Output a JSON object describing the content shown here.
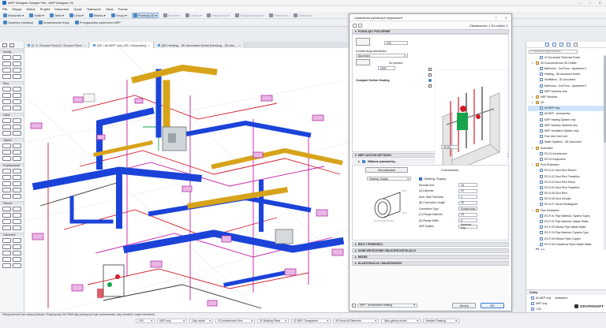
{
  "window": {
    "title": "MEP Designer Sample File - MEP Designer 29"
  },
  "menu": [
    "Plik",
    "Edycja",
    "Widok",
    "Projekt",
    "Dokument",
    "Opcje",
    "Teamwork",
    "Okna",
    "Pomoc"
  ],
  "toolbar1": [
    {
      "label": "Wskaźnik",
      "active": false
    },
    {
      "label": "Siatki",
      "active": false
    },
    {
      "label": "Tekst",
      "active": false
    },
    {
      "label": "Linia",
      "active": false
    },
    {
      "label": "Miarka",
      "active": false
    },
    {
      "label": "Grupy",
      "active": false
    },
    {
      "label": "Przekrój 3D",
      "active": true
    },
    {
      "label": "Pomiar",
      "active": false,
      "dim": true
    },
    {
      "label": "Ustaw",
      "active": false,
      "dim": true
    },
    {
      "label": "Połączenie",
      "active": false,
      "dim": true
    },
    {
      "label": "Edycja bryłowa",
      "active": false,
      "dim": true
    },
    {
      "label": "Przesuń",
      "active": false,
      "dim": true
    },
    {
      "label": "Zastosuj",
      "active": false,
      "dim": true
    }
  ],
  "toolbar2": [
    {
      "label": "Systemy instalacji"
    },
    {
      "label": "Sprawdzanie trasy"
    },
    {
      "label": "Przeglądarka systemów MEP"
    }
  ],
  "left_sections": [
    {
      "title": "Kanały",
      "rows": 4
    },
    {
      "title": "Rury",
      "rows": 4
    },
    {
      "title": "Kable",
      "rows": 3
    },
    {
      "title": "Ogólne",
      "rows": 3
    },
    {
      "title": "Projektowanie",
      "rows": 5
    },
    {
      "title": "Główne",
      "rows": 4
    },
    {
      "title": "Dokument",
      "rows": 5
    }
  ],
  "tabs": [
    {
      "label": "[2. 0. Ground Floor] 0. Ground Floor",
      "active": false
    },
    {
      "label": "[3D / All MEP only (3D / Wszystko)]",
      "active": true
    },
    {
      "label": "[3D Heating - 3D document Detail (Heating - 3D doc...",
      "active": false
    }
  ],
  "dialog": {
    "title": "Ustawienia wybranych wyposażeń",
    "selected": "Zaznaczono: 1 Do zmian: 1",
    "sec_floor": "PODGLĄD I POŁOŻENIE",
    "floor_value": "200",
    "construction_label": "Konstrukcja elementu:",
    "construction_value": "Basement",
    "level_label": "Do poziomu:",
    "level_value": "2000",
    "element_name": "Compact Dielion Heating",
    "preview_number": "09.537",
    "sec_custom": "MEP CUSTOM SETTINGS",
    "sub_params": "Własne parametry...",
    "tab_visualization": "Visualization",
    "tab_connections": "Connections",
    "conn_left_label": "Heating, Supply",
    "conn_right_label": "Heating, Supply",
    "param_rows": [
      {
        "label": "Nominal Size",
        "value": "15"
      },
      {
        "label": "(A) Diameter",
        "value": "22"
      },
      {
        "label": "Nom. Wall Thickness",
        "value": "1"
      },
      {
        "label": "(B) Connection Length",
        "value": "15"
      },
      {
        "label": "Connection Type",
        "value": "Kołnierzowe"
      },
      {
        "label": "(C) Flange Diameter",
        "value": "25"
      },
      {
        "label": "(D) Flange Width",
        "value": "4"
      },
      {
        "label": "MEP System",
        "value": "Hydronic Sup"
      }
    ],
    "sec_rzut": "RZUT I PRZEKRÓJ",
    "sec_dane": "DANE WEJŚCIOWE OBLICZEŃ INSTALACJI",
    "sec_model": "MODEL",
    "sec_klas": "KLASYFIKACJA I WŁAŚCIWOŚCI",
    "footer_label": "MEP - Accessories Heating",
    "cancel": "Anuluj",
    "ok": "OK"
  },
  "nav": {
    "search_placeholder": "Przeszukaj Mapę widoków",
    "items": [
      {
        "label": "02 Document Technical Room",
        "level": 2,
        "type": "doc"
      },
      {
        "label": "3D Documents and 3D Details",
        "level": 1,
        "type": "folder",
        "open": true
      },
      {
        "label": "Bathroom - 2nd Floor - Apartment 1",
        "level": 2,
        "type": "doc"
      },
      {
        "label": "Heating - 3D document Detail",
        "level": 2,
        "type": "doc"
      },
      {
        "label": "Ventilation - 3D Document",
        "level": 2,
        "type": "doc"
      },
      {
        "label": "Bathroom - 2nd Floor - Apartment 2",
        "level": 2,
        "type": "doc"
      },
      {
        "label": "MEP Systems only",
        "level": 2,
        "type": "doc"
      },
      {
        "label": "MEP Sections",
        "level": 1,
        "type": "folder",
        "open": true
      },
      {
        "label": "3D",
        "level": 1,
        "type": "folder",
        "open": true
      },
      {
        "label": "All MEP only",
        "level": 2,
        "type": "doc",
        "selected": true
      },
      {
        "label": "All MEP - Axonometry",
        "level": 2,
        "type": "doc"
      },
      {
        "label": "MEP Heating System only",
        "level": 2,
        "type": "doc"
      },
      {
        "label": "MEP Sanitary Systems only",
        "level": 2,
        "type": "doc"
      },
      {
        "label": "MEP Ventilation System only",
        "level": 2,
        "type": "doc"
      },
      {
        "label": "Flue Vent Vent Unit",
        "level": 2,
        "type": "doc"
      },
      {
        "label": "Water Systems - 3D Document",
        "level": 2,
        "type": "doc"
      },
      {
        "label": "Schedules",
        "level": 1,
        "type": "folder",
        "open": true
      },
      {
        "label": "ES-01 Accessories",
        "level": 2,
        "type": "doc"
      },
      {
        "label": "ES-02 Equipment",
        "level": 2,
        "type": "doc"
      },
      {
        "label": "Duct Schedules",
        "level": 1,
        "type": "folder",
        "open": true
      },
      {
        "label": "ES-D-01 Duct Rect Branch",
        "level": 2,
        "type": "doc"
      },
      {
        "label": "ES-D-02 Duct Rect Transition",
        "level": 2,
        "type": "doc"
      },
      {
        "label": "ES-D-03 Duct Rect Elbow",
        "level": 2,
        "type": "doc"
      },
      {
        "label": "ES-D-04 Duct Rect Transition",
        "level": 2,
        "type": "doc"
      },
      {
        "label": "ES-D-05 Duct Rect",
        "level": 2,
        "type": "doc"
      },
      {
        "label": "ES-D-06 Duct Circular",
        "level": 2,
        "type": "doc"
      },
      {
        "label": "ES-D-07 Ducts Rectangular",
        "level": 2,
        "type": "doc"
      },
      {
        "label": "Pipe Schedules",
        "level": 1,
        "type": "folder",
        "open": true
      },
      {
        "label": "ES-P-01 Pipe Material / System Types",
        "level": 2,
        "type": "doc"
      },
      {
        "label": "ES-P-02 Pipe Material / Waste Water",
        "level": 2,
        "type": "doc"
      },
      {
        "label": "ES-P-03 Elbows Pipe Waste Water",
        "level": 2,
        "type": "doc"
      },
      {
        "label": "ES-P-04 Pipe Material / System Type",
        "level": 2,
        "type": "doc"
      },
      {
        "label": "ES-P-05 Elbows Pipes Copper",
        "level": 2,
        "type": "doc"
      },
      {
        "label": "ES-P-06 Transitions Pipes Waste Water",
        "level": 2,
        "type": "doc"
      },
      {
        "label": "Info",
        "level": 1,
        "type": "doc"
      }
    ],
    "props_title": "Cechy",
    "props": [
      {
        "label": "All MEP only"
      },
      {
        "label": "MEP only"
      },
      {
        "label": "1:50"
      },
      {
        "label": "Obiekt: 3D"
      }
    ],
    "settings_label": "Ustawienia...",
    "brand": "GRAPHISOFT"
  },
  "status": {
    "message": "Kliknij element lub narysuj obszar. Przytrzymaj Ctrl+Shift aby przełączyć tryb zaznaczania: cały element / część elementu.",
    "fields": [
      {
        "label": "1:50"
      },
      {
        "label": "MEP only"
      },
      {
        "label": "Cały model"
      },
      {
        "label": "03 Architectural View"
      },
      {
        "label": "03 Building Plans"
      },
      {
        "label": "02 MEP Transparent"
      },
      {
        "label": "08 Show All Elements"
      },
      {
        "label": "Tylko główny model"
      },
      {
        "label": "Detailed Shading"
      }
    ]
  },
  "colors": {
    "duct_blue": "#1b43d8",
    "duct_yellow": "#d7a31a",
    "pipe_red": "#d21c2a",
    "pipe_magenta": "#c21fa6",
    "pipe_green": "#16a34a",
    "accent": "#3b7bd4"
  }
}
